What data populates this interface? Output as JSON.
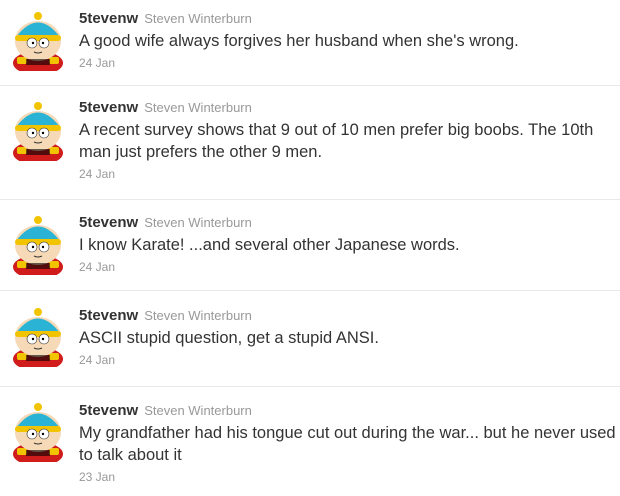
{
  "colors": {
    "handle": "#333333",
    "secondary": "#999999",
    "divider": "#e8e8e8",
    "avatar_hat": "#2ab3d4",
    "avatar_jacket": "#d11c1c",
    "avatar_skin": "#f6d9b6"
  },
  "tweets": [
    {
      "handle": "5tevenw",
      "name": "Steven Winterburn",
      "avatar": "cartman-avatar",
      "text": "A good wife always forgives her husband when she's wrong.",
      "time": "24 Jan"
    },
    {
      "handle": "5tevenw",
      "name": "Steven Winterburn",
      "avatar": "cartman-avatar",
      "text": "A recent survey shows that 9 out of 10 men prefer big boobs. The 10th man just prefers the other 9 men.",
      "time": "24 Jan"
    },
    {
      "handle": "5tevenw",
      "name": "Steven Winterburn",
      "avatar": "cartman-avatar",
      "text": "I know Karate! ...and several other Japanese words.",
      "time": "24 Jan"
    },
    {
      "handle": "5tevenw",
      "name": "Steven Winterburn",
      "avatar": "cartman-avatar",
      "text": "ASCII stupid question, get a stupid ANSI.",
      "time": "24 Jan"
    },
    {
      "handle": "5tevenw",
      "name": "Steven Winterburn",
      "avatar": "cartman-avatar",
      "text": "My grandfather had his tongue cut out during the war... but he never used to talk about it",
      "time": "23 Jan"
    }
  ]
}
